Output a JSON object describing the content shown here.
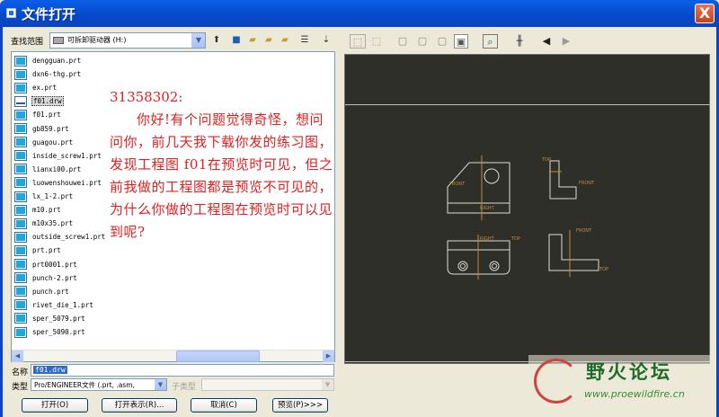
{
  "window": {
    "title": "文件打开",
    "close_glyph": "X"
  },
  "lookin": {
    "label": "查找范围",
    "value": "可拆卸驱动器 (H:)"
  },
  "files": [
    {
      "name": "dengguan.prt",
      "kind": "prt"
    },
    {
      "name": "dxn6-thg.prt",
      "kind": "prt"
    },
    {
      "name": "ex.prt",
      "kind": "prt"
    },
    {
      "name": "f01.drw",
      "kind": "drw",
      "selected": true
    },
    {
      "name": "f01.prt",
      "kind": "prt"
    },
    {
      "name": "gb859.prt",
      "kind": "prt"
    },
    {
      "name": "guagou.prt",
      "kind": "prt"
    },
    {
      "name": "inside_screw1.prt",
      "kind": "prt"
    },
    {
      "name": "lianxi00.prt",
      "kind": "prt"
    },
    {
      "name": "luowenshouwei.prt",
      "kind": "prt"
    },
    {
      "name": "lx_1-2.prt",
      "kind": "prt"
    },
    {
      "name": "m10.prt",
      "kind": "prt"
    },
    {
      "name": "m10x35.prt",
      "kind": "prt"
    },
    {
      "name": "outside_screw1.prt",
      "kind": "prt"
    },
    {
      "name": "prt.prt",
      "kind": "prt"
    },
    {
      "name": "prt0001.prt",
      "kind": "prt"
    },
    {
      "name": "punch-2.prt",
      "kind": "prt"
    },
    {
      "name": "punch.prt",
      "kind": "prt"
    },
    {
      "name": "rivet_die_1.prt",
      "kind": "prt"
    },
    {
      "name": "sper_5079.prt",
      "kind": "prt"
    },
    {
      "name": "sper_5090.prt",
      "kind": "prt"
    }
  ],
  "note": {
    "number": "31358302:",
    "text": "你好!有个问题觉得奇怪，想问问你，前几天我下载你发的练习图，发现工程图 f01在预览时可见，但之前我做的工程图都是预览不可见的，为什么你做的工程图在预览时可以见到呢?"
  },
  "name_field": {
    "label": "名称",
    "value": "f01.drw"
  },
  "type_field": {
    "label": "类型",
    "value": "Pro/ENGINEER文件 (.prt, .asm,"
  },
  "subtype_field": {
    "label": "子类型",
    "value": ""
  },
  "buttons": {
    "open": "打开(O)",
    "open_rep": "打开表示(R)...",
    "cancel": "取消(C)",
    "preview": "预览(P)>>>"
  },
  "drawing_labels": {
    "front": "FRONT",
    "top": "TOP",
    "right": "RIGHT"
  },
  "watermark": {
    "title": "野火论坛",
    "url": "www.proewildfire.cn"
  },
  "colors": {
    "title_bar": "#0A5FE6",
    "preview_bg": "#2F2F2A",
    "note_text": "#E02020",
    "selection": "#316AC5"
  }
}
